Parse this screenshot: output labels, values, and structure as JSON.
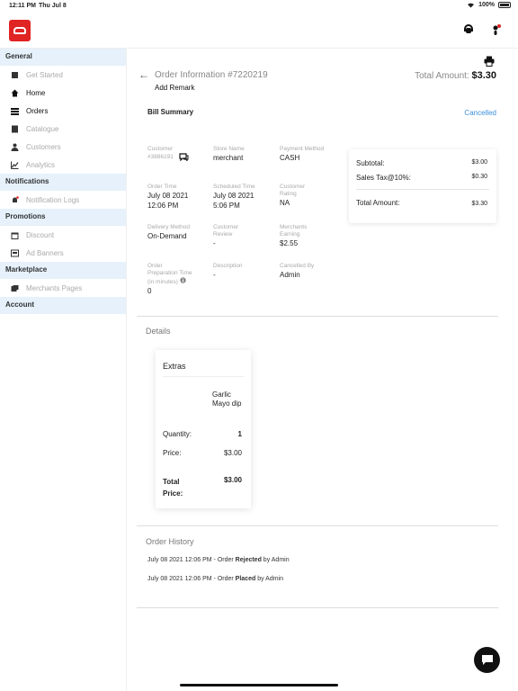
{
  "status_bar": {
    "time": "12:11 PM",
    "date": "Thu Jul 8",
    "battery": "100%"
  },
  "sidebar": {
    "sections": [
      {
        "title": "General",
        "items": [
          {
            "label": "Get Started",
            "icon": "getting-started-icon",
            "state": "disabled"
          },
          {
            "label": "Home",
            "icon": "home-icon",
            "state": "active"
          },
          {
            "label": "Orders",
            "icon": "orders-icon",
            "state": "active"
          },
          {
            "label": "Catalogue",
            "icon": "catalogue-icon",
            "state": "disabled"
          },
          {
            "label": "Customers",
            "icon": "customers-icon",
            "state": "disabled"
          },
          {
            "label": "Analytics",
            "icon": "analytics-icon",
            "state": "disabled"
          }
        ]
      },
      {
        "title": "Notifications",
        "items": [
          {
            "label": "Notification Logs",
            "icon": "notification-logs-icon",
            "state": "disabled"
          }
        ]
      },
      {
        "title": "Promotions",
        "items": [
          {
            "label": "Discount",
            "icon": "discount-icon",
            "state": "disabled"
          },
          {
            "label": "Ad Banners",
            "icon": "ad-banners-icon",
            "state": "disabled"
          }
        ]
      },
      {
        "title": "Marketplace",
        "items": [
          {
            "label": "Merchants Pages",
            "icon": "merchants-pages-icon",
            "state": "disabled"
          }
        ]
      },
      {
        "title": "Account",
        "items": []
      }
    ]
  },
  "order": {
    "title": "Order Information #7220219",
    "add_remark": "Add Remark",
    "total_amount_label": "Total Amount:",
    "total_amount_value": "$3.30",
    "bill_summary": "Bill Summary",
    "status": "Cancelled",
    "info": {
      "customer_label": "Customer",
      "customer_value": "#3886191",
      "store_name_label": "Store Name",
      "store_name_value": "merchant",
      "payment_method_label": "Payment Method",
      "payment_method_value": "CASH",
      "order_time_label": "Order Time",
      "order_time_value": "July 08 2021 12:06 PM",
      "scheduled_time_label": "Scheduled Time",
      "scheduled_time_value": "July 08 2021 5:06 PM",
      "customer_rating_label": "Customer Rating",
      "customer_rating_value": "NA",
      "delivery_method_label": "Delivery Method",
      "delivery_method_value": "On-Demand",
      "customer_review_label": "Customer Review",
      "customer_review_value": "-",
      "merchants_earning_label": "Merchants Earning",
      "merchants_earning_value": "$2.55",
      "prep_time_label": "Order Preparation Time (in minutes)",
      "prep_time_value": "0",
      "description_label": "Description",
      "description_value": "-",
      "cancelled_by_label": "Cancelled By",
      "cancelled_by_value": "Admin"
    },
    "summary": {
      "subtotal_label": "Subtotal:",
      "subtotal_value": "$3.00",
      "tax_label": "Sales Tax@10%:",
      "tax_value": "$0.30",
      "total_label": "Total Amount:",
      "total_value": "$3.30"
    },
    "details": {
      "title": "Details",
      "card_title": "Extras",
      "item_name": "Garlic Mayo dip",
      "quantity_label": "Quantity:",
      "quantity_value": "1",
      "price_label": "Price:",
      "price_value": "$3.00",
      "total_price_label": "Total Price:",
      "total_price_value": "$3.00"
    },
    "history": {
      "title": "Order History",
      "entries": [
        {
          "pre": "July 08 2021 12:06 PM - Order ",
          "action": "Rejected",
          "post": " by Admin"
        },
        {
          "pre": "July 08 2021 12:06 PM - Order ",
          "action": "Placed",
          "post": " by Admin"
        }
      ]
    }
  }
}
